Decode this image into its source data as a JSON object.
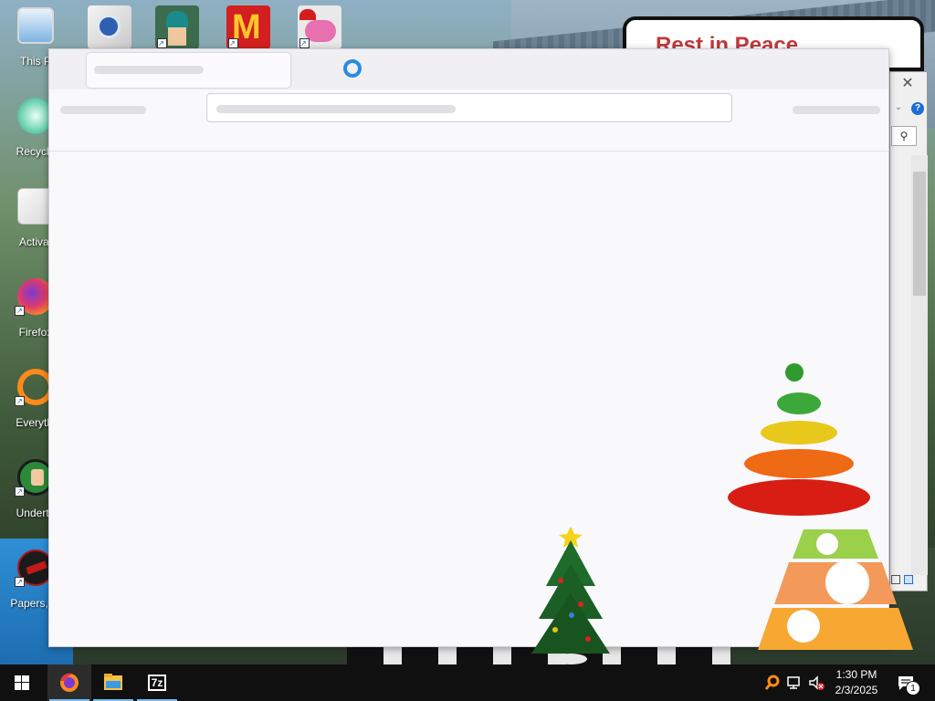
{
  "wallpaper": {
    "sign_text": "Rest in Peace"
  },
  "desktop_icons": [
    {
      "label": "This P",
      "icon": "computer-icon"
    },
    {
      "label": "Recycle",
      "icon": "recycle-bin-icon"
    },
    {
      "label": "Activat",
      "icon": "folder-icon"
    },
    {
      "label": "Firefox",
      "icon": "firefox-icon"
    },
    {
      "label": "Everythi",
      "icon": "everything-search-icon"
    },
    {
      "label": "Underta",
      "icon": "undertale-icon"
    },
    {
      "label": "Papers, Pl",
      "icon": "papers-please-icon"
    }
  ],
  "top_icons": [
    {
      "icon": "media-app-icon"
    },
    {
      "icon": "game-character-icon"
    },
    {
      "icon": "mcdonalds-icon"
    },
    {
      "icon": "pig-santa-icon"
    }
  ],
  "browser": {
    "state": "loading",
    "spinner_color": "#2a8be0"
  },
  "back_window": {
    "close_glyph": "✕",
    "help_glyph": "?",
    "chevron_glyph": "⌄",
    "search_glyph": "⚲"
  },
  "taskbar": {
    "apps": [
      {
        "name": "firefox",
        "icon": "firefox-icon",
        "active": true
      },
      {
        "name": "file-explorer",
        "icon": "folder-icon",
        "active": false
      },
      {
        "name": "7-zip",
        "icon": "seven-zip-icon",
        "label": "7z",
        "active": false
      }
    ],
    "clock": {
      "time": "1:30 PM",
      "date": "2/3/2025"
    },
    "notification_count": "1"
  },
  "colors": {
    "taskbar_bg": "#101010",
    "window_bg": "#f9f9fb",
    "accent": "#2a8be0",
    "sign_text": "#c0393b"
  }
}
